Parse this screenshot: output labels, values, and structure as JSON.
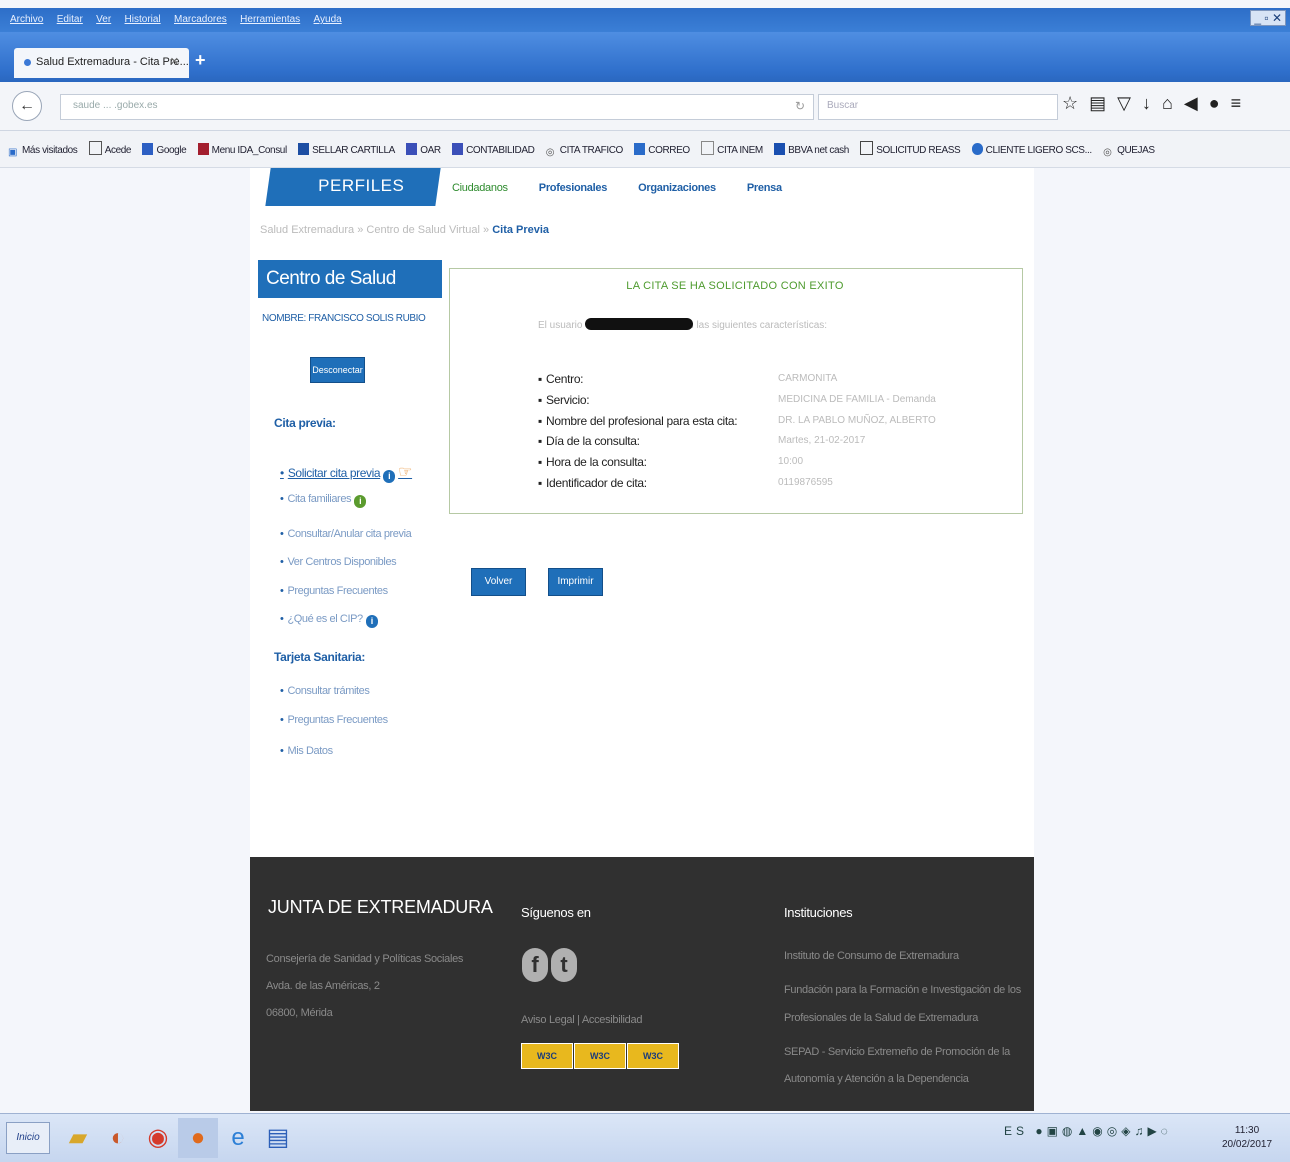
{
  "browser": {
    "menu": [
      "Archivo",
      "Editar",
      "Ver",
      "Historial",
      "Marcadores",
      "Herramientas",
      "Ayuda"
    ],
    "tab_title": "Salud Extremadura - Cita Pre...",
    "url_prefix": "saude ... .gobex.es",
    "search_placeholder": "Buscar",
    "bookmarks": [
      "Más visitados",
      "Acede",
      "Google",
      "Menu IDA_Consul",
      "SELLAR CARTILLA",
      "OAR",
      "CONTABILIDAD",
      "CITA TRAFICO",
      "CORREO",
      "CITA INEM",
      "BBVA net cash",
      "SOLICITUD REASS",
      "CLIENTE LIGERO SCS...",
      "QUEJAS"
    ]
  },
  "nav": {
    "perfiles": "PERFILES",
    "items": [
      "Ciudadanos",
      "Profesionales",
      "Organizaciones",
      "Prensa"
    ]
  },
  "breadcrumb": {
    "part1": "Salud Extremadura",
    "part2": "Centro de Salud Virtual",
    "current": "Cita Previa"
  },
  "sidebar": {
    "title": "Centro de Salud Virtual",
    "nombre": "NOMBRE: FRANCISCO SOLIS RUBIO",
    "desconectar": "Desconectar",
    "cita_heading": "Cita previa:",
    "cita_links": [
      "Solicitar cita previa",
      "Cita familiares",
      "Consultar/Anular cita previa",
      "Ver Centros Disponibles",
      "Preguntas Frecuentes",
      "¿Qué es el CIP?"
    ],
    "tarjeta_heading": "Tarjeta Sanitaria:",
    "tarjeta_links": [
      "Consultar trámites",
      "Preguntas Frecuentes",
      "Mis Datos"
    ]
  },
  "result": {
    "heading": "LA CITA SE HA SOLICITADO CON EXITO",
    "intro": "El usuario                              tiene una nueva cita con las siguientes características:",
    "labels": [
      "Centro:",
      "Servicio:",
      "Nombre del profesional para esta cita:",
      "Día de la consulta:",
      "Hora de la consulta:",
      "Identificador de cita:"
    ],
    "values": [
      "CARMONITA",
      "MEDICINA DE FAMILIA - Demanda",
      "DR. LA  PABLO MUÑOZ, ALBERTO",
      "Martes, 21-02-2017",
      "10:00",
      "0119876595"
    ]
  },
  "buttons": {
    "volver": "Volver",
    "imprimir": "Imprimir"
  },
  "footer": {
    "org": "JUNTA DE EXTREMADURA",
    "address": [
      "Consejería de Sanidad y Políticas Sociales",
      "Avda. de las Américas, 2",
      "06800, Mérida"
    ],
    "follow": "Síguenos en",
    "legal": "Aviso Legal | Accesibilidad",
    "inst_heading": "Instituciones",
    "inst": [
      "Instituto de Consumo de Extremadura",
      "Fundación para la Formación e Investigación de los",
      "Profesionales de la Salud de Extremadura",
      "SEPAD - Servicio Extremeño de Promoción de la",
      "Autonomía y Atención a la Dependencia"
    ]
  },
  "taskbar": {
    "start": "Inicio",
    "lang": "ES",
    "time": "11:30",
    "date": "20/02/2017"
  }
}
